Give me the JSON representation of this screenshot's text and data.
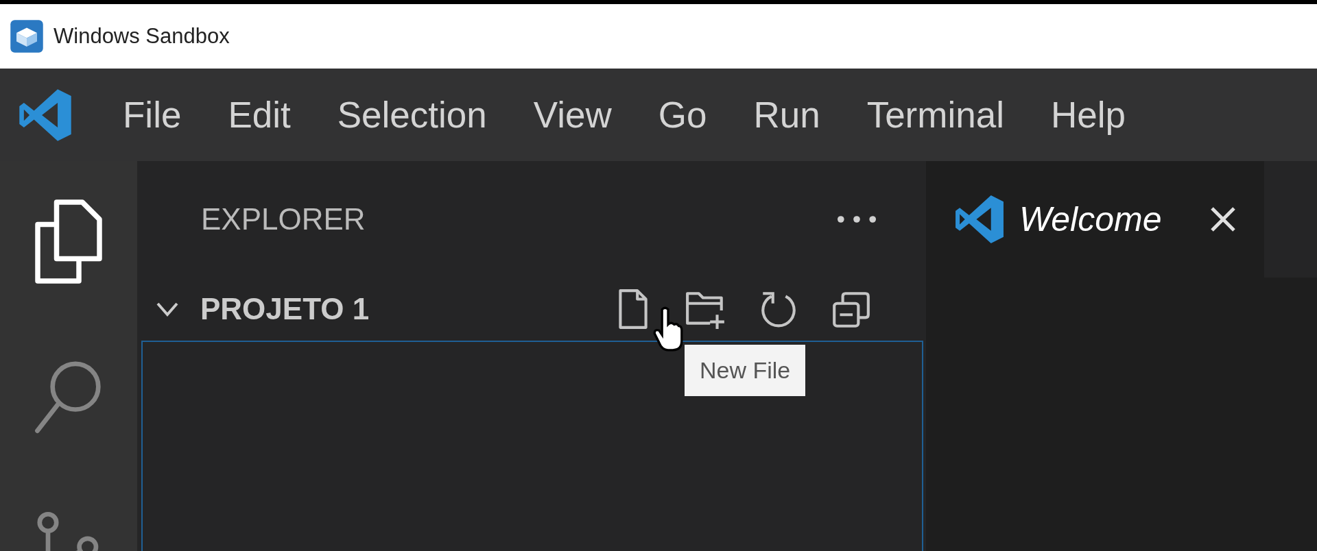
{
  "window": {
    "title": "Windows Sandbox"
  },
  "menu": [
    "File",
    "Edit",
    "Selection",
    "View",
    "Go",
    "Run",
    "Terminal",
    "Help"
  ],
  "activity_bar": [
    {
      "kind": "explorer",
      "selected": true
    },
    {
      "kind": "search",
      "selected": false
    },
    {
      "kind": "source-control",
      "selected": false
    }
  ],
  "sidebar": {
    "title": "EXPLORER",
    "section": {
      "title": "PROJETO 1",
      "expanded": true,
      "focused": true,
      "actions": [
        {
          "kind": "new-file"
        },
        {
          "kind": "new-folder"
        },
        {
          "kind": "refresh"
        },
        {
          "kind": "collapse"
        }
      ]
    },
    "tooltip": "New File"
  },
  "tabs": [
    {
      "label": "Welcome",
      "selected": true
    }
  ]
}
